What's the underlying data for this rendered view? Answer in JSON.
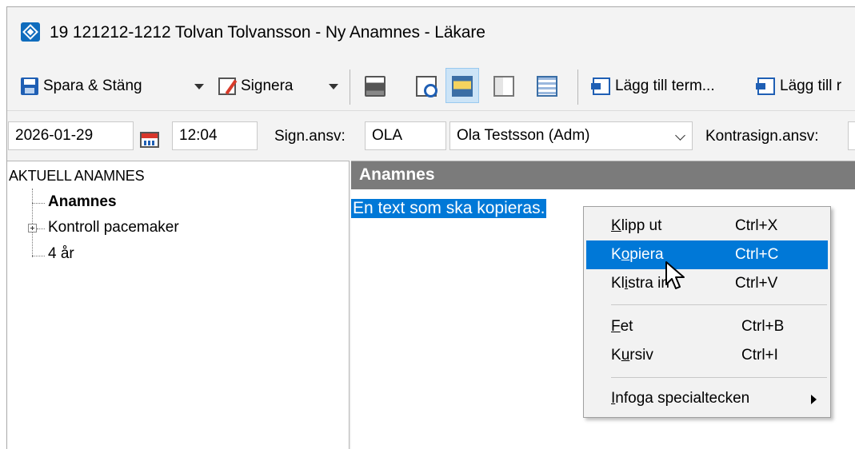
{
  "window": {
    "title": "19 121212-1212 Tolvan Tolvansson - Ny Anamnes - Läkare"
  },
  "toolbar": {
    "save_close_label": "Spara & Stäng",
    "sign_label": "Signera",
    "add_term_label": "Lägg till term...",
    "add_more_label": "Lägg till r"
  },
  "fields": {
    "date": "2026-01-29",
    "time": "12:04",
    "sign_resp_label": "Sign.ansv:",
    "sign_resp_code": "OLA",
    "sign_resp_name": "Ola Testsson (Adm)",
    "countersign_label": "Kontrasign.ansv:"
  },
  "tree": {
    "root": "AKTUELL ANAMNES",
    "nodes": [
      "Anamnes",
      "Kontroll pacemaker",
      "4 år"
    ]
  },
  "editor": {
    "header": "Anamnes",
    "text": "En text som ska kopieras."
  },
  "context_menu": {
    "items": [
      {
        "pre": "",
        "key": "K",
        "post": "lipp ut",
        "shortcut": "Ctrl+X"
      },
      {
        "pre": "K",
        "key": "o",
        "post": "piera",
        "shortcut": "Ctrl+C"
      },
      {
        "pre": "Kl",
        "key": "i",
        "post": "stra in",
        "shortcut": "Ctrl+V"
      },
      {
        "pre": "",
        "key": "F",
        "post": "et",
        "shortcut": "Ctrl+B"
      },
      {
        "pre": "K",
        "key": "u",
        "post": "rsiv",
        "shortcut": "Ctrl+I"
      },
      {
        "pre": "",
        "key": "I",
        "post": "nfoga specialtecken",
        "shortcut": ""
      }
    ]
  },
  "colors": {
    "selection": "#0078d7",
    "pane_header": "#7b7b7b",
    "chrome": "#f3f3f3"
  }
}
